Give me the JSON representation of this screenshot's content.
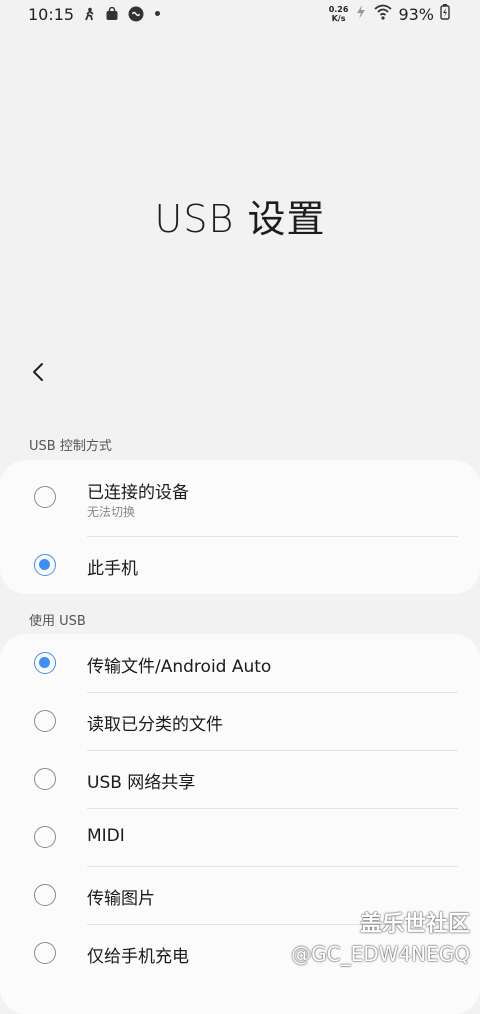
{
  "status_bar": {
    "time": "10:15",
    "net_speed_value": "0.26",
    "net_speed_unit": "K/s",
    "battery": "93%"
  },
  "page": {
    "title": "USB 设置"
  },
  "sections": [
    {
      "label": "USB 控制方式",
      "items": [
        {
          "label": "已连接的设备",
          "sub": "无法切换",
          "checked": false
        },
        {
          "label": "此手机",
          "checked": true
        }
      ]
    },
    {
      "label": "使用 USB",
      "items": [
        {
          "label": "传输文件/Android Auto",
          "checked": true
        },
        {
          "label": "读取已分类的文件",
          "checked": false
        },
        {
          "label": "USB 网络共享",
          "checked": false
        },
        {
          "label": "MIDI",
          "checked": false
        },
        {
          "label": "传输图片",
          "checked": false
        },
        {
          "label": "仅给手机充电",
          "checked": false
        }
      ]
    }
  ],
  "watermark": {
    "line1": "盖乐世社区",
    "line2": "@GC_EDW4NEGQ"
  },
  "colors": {
    "accent": "#3e8ef7",
    "background": "#f2f2f2",
    "card": "#fbfbfb"
  },
  "icons": [
    "back-icon",
    "wifi-icon",
    "battery-icon",
    "bag-icon",
    "game-icon",
    "runner-icon",
    "charging-icon"
  ]
}
